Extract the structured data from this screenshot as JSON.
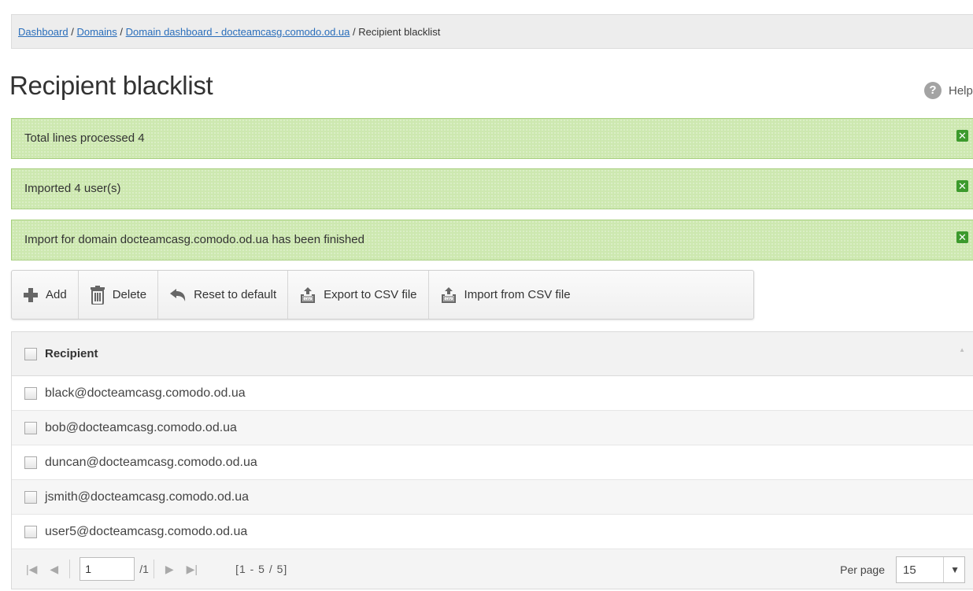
{
  "breadcrumb": {
    "items": [
      "Dashboard",
      "Domains",
      "Domain dashboard - docteamcasg.comodo.od.ua"
    ],
    "separator": "/",
    "current": "Recipient blacklist"
  },
  "page": {
    "title": "Recipient blacklist",
    "help_label": "Help",
    "help_glyph": "?"
  },
  "alerts": [
    "Total lines processed 4",
    "Imported 4 user(s)",
    "Import for domain docteamcasg.comodo.od.ua has been finished"
  ],
  "toolbar": {
    "add": "Add",
    "delete": "Delete",
    "reset": "Reset to default",
    "export": "Export to CSV file",
    "import": "Import from CSV file"
  },
  "grid": {
    "column_header": "Recipient",
    "rows": [
      "black@docteamcasg.comodo.od.ua",
      "bob@docteamcasg.comodo.od.ua",
      "duncan@docteamcasg.comodo.od.ua",
      "jsmith@docteamcasg.comodo.od.ua",
      "user5@docteamcasg.comodo.od.ua"
    ]
  },
  "pager": {
    "page": "1",
    "total_pages": "/1",
    "range": "[1 - 5 / 5]",
    "per_page_label": "Per page",
    "per_page_value": "15"
  },
  "colors": {
    "alert_bg": "#cde8b0",
    "alert_border": "#a7cf7e",
    "alert_close": "#3c9a2d",
    "link": "#2a6ebb"
  }
}
